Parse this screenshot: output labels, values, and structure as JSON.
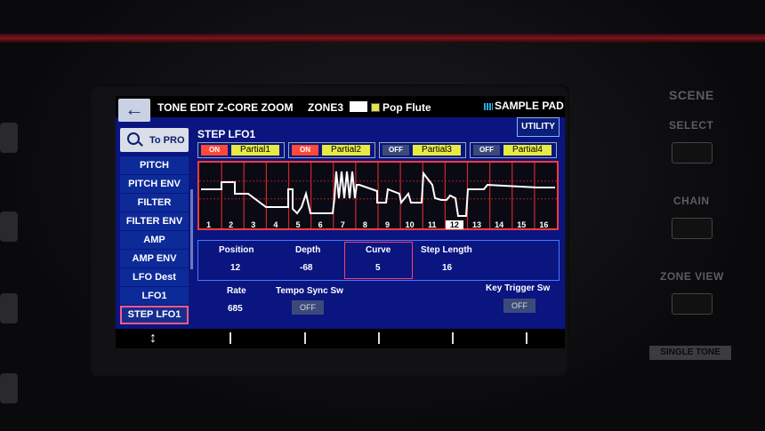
{
  "header": {
    "back_icon": "arrow-left-icon",
    "title": "TONE EDIT Z-CORE ZOOM",
    "zone": "ZONE3",
    "tone_name": "Pop Flute",
    "sample_pad": "SAMPLE PAD",
    "utility": "UTILITY"
  },
  "sidebar": {
    "to_pro": "To PRO",
    "items": [
      {
        "label": "PITCH"
      },
      {
        "label": "PITCH ENV"
      },
      {
        "label": "FILTER"
      },
      {
        "label": "FILTER ENV"
      },
      {
        "label": "AMP"
      },
      {
        "label": "AMP ENV"
      },
      {
        "label": "LFO Dest"
      },
      {
        "label": "LFO1"
      },
      {
        "label": "STEP LFO1"
      }
    ],
    "selected_index": 8
  },
  "main": {
    "section_title": "STEP LFO1",
    "partials": [
      {
        "switch": "ON",
        "name": "Partial1",
        "switch_color": "#ff4a3a"
      },
      {
        "switch": "ON",
        "name": "Partial2",
        "switch_color": "#ff4a3a"
      },
      {
        "switch": "OFF",
        "name": "Partial3",
        "switch_color": "#3c4a7a"
      },
      {
        "switch": "OFF",
        "name": "Partial4",
        "switch_color": "#3c4a7a"
      }
    ],
    "steps": [
      "1",
      "2",
      "3",
      "4",
      "5",
      "6",
      "7",
      "8",
      "9",
      "10",
      "11",
      "12",
      "13",
      "14",
      "15",
      "16"
    ],
    "selected_step": "12",
    "params": {
      "position_label": "Position",
      "position_value": "12",
      "depth_label": "Depth",
      "depth_value": "-68",
      "curve_label": "Curve",
      "curve_value": "5",
      "step_length_label": "Step Length",
      "step_length_value": "16",
      "rate_label": "Rate",
      "rate_value": "685",
      "tempo_sync_label": "Tempo Sync Sw",
      "tempo_sync_value": "OFF",
      "key_trigger_label": "Key Trigger Sw",
      "key_trigger_value": "OFF"
    }
  },
  "footer": {
    "updown_icon": "up-down-arrow-icon",
    "updown": "↕"
  },
  "panel": {
    "scene": "SCENE",
    "select": "SELECT",
    "chain": "CHAIN",
    "zone_view": "ZONE VIEW",
    "single_tone": "SINGLE TONE"
  },
  "colors": {
    "screen_bg": "#0a1580",
    "accent_red": "#ff3b3b",
    "partial_yellow": "#e6ea42",
    "selection_pink": "#ff5a8a"
  }
}
